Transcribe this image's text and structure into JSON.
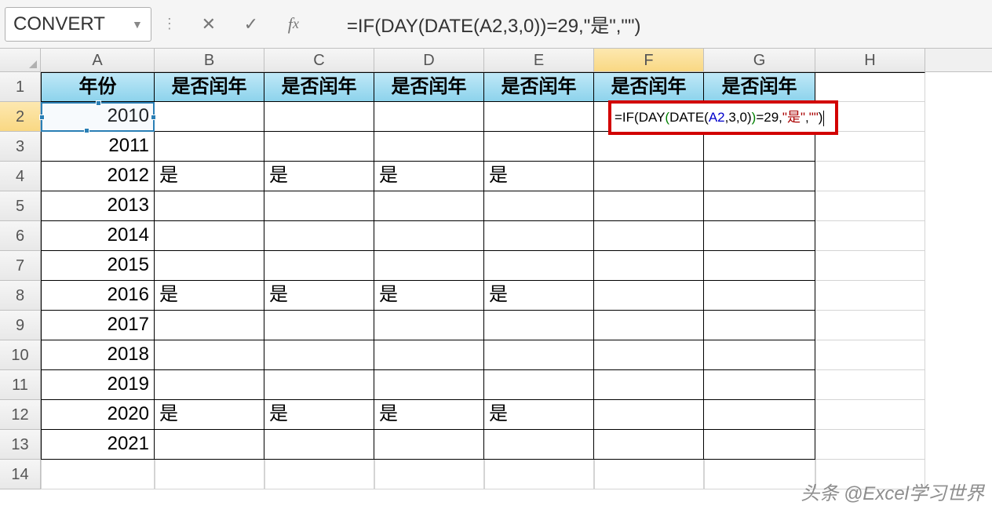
{
  "formula_bar": {
    "namebox": "CONVERT",
    "formula": "=IF(DAY(DATE(A2,3,0))=29,\"是\",\"\")"
  },
  "columns": [
    "A",
    "B",
    "C",
    "D",
    "E",
    "F",
    "G",
    "H"
  ],
  "header_row": {
    "A": "年份",
    "B": "是否闰年",
    "C": "是否闰年",
    "D": "是否闰年",
    "E": "是否闰年",
    "F": "是否闰年",
    "G": "是否闰年"
  },
  "rows": [
    {
      "n": 2,
      "A": "2010",
      "B": "",
      "C": "",
      "D": "",
      "E": "",
      "F": "",
      "G": "",
      "editingF": true
    },
    {
      "n": 3,
      "A": "2011",
      "B": "",
      "C": "",
      "D": "",
      "E": "",
      "F": "",
      "G": ""
    },
    {
      "n": 4,
      "A": "2012",
      "B": "是",
      "C": "是",
      "D": "是",
      "E": "是",
      "F": "",
      "G": ""
    },
    {
      "n": 5,
      "A": "2013",
      "B": "",
      "C": "",
      "D": "",
      "E": "",
      "F": "",
      "G": ""
    },
    {
      "n": 6,
      "A": "2014",
      "B": "",
      "C": "",
      "D": "",
      "E": "",
      "F": "",
      "G": ""
    },
    {
      "n": 7,
      "A": "2015",
      "B": "",
      "C": "",
      "D": "",
      "E": "",
      "F": "",
      "G": ""
    },
    {
      "n": 8,
      "A": "2016",
      "B": "是",
      "C": "是",
      "D": "是",
      "E": "是",
      "F": "",
      "G": ""
    },
    {
      "n": 9,
      "A": "2017",
      "B": "",
      "C": "",
      "D": "",
      "E": "",
      "F": "",
      "G": ""
    },
    {
      "n": 10,
      "A": "2018",
      "B": "",
      "C": "",
      "D": "",
      "E": "",
      "F": "",
      "G": ""
    },
    {
      "n": 11,
      "A": "2019",
      "B": "",
      "C": "",
      "D": "",
      "E": "",
      "F": "",
      "G": ""
    },
    {
      "n": 12,
      "A": "2020",
      "B": "是",
      "C": "是",
      "D": "是",
      "E": "是",
      "F": "",
      "G": ""
    },
    {
      "n": 13,
      "A": "2021",
      "B": "",
      "C": "",
      "D": "",
      "E": "",
      "F": "",
      "G": ""
    },
    {
      "n": 14,
      "A": "",
      "B": "",
      "C": "",
      "D": "",
      "E": "",
      "F": "",
      "G": "",
      "blank": true
    }
  ],
  "f2_edit_tokens": [
    {
      "t": "=IF",
      "c": "tok-black"
    },
    {
      "t": "(",
      "c": "tok-paren1"
    },
    {
      "t": "DAY",
      "c": "tok-black"
    },
    {
      "t": "(",
      "c": "tok-paren2"
    },
    {
      "t": "DATE",
      "c": "tok-black"
    },
    {
      "t": "(",
      "c": "tok-paren1"
    },
    {
      "t": "A2",
      "c": "tok-blue"
    },
    {
      "t": ",3,0",
      "c": "tok-black"
    },
    {
      "t": ")",
      "c": "tok-paren1"
    },
    {
      "t": ")",
      "c": "tok-paren2"
    },
    {
      "t": "=29,",
      "c": "tok-black"
    },
    {
      "t": "\"是\"",
      "c": "tok-str"
    },
    {
      "t": ",",
      "c": "tok-black"
    },
    {
      "t": "\"\"",
      "c": "tok-str"
    },
    {
      "t": ")",
      "c": "tok-paren1"
    }
  ],
  "watermark": "头条 @Excel学习世界",
  "selected_cell": "A2",
  "editing_cell": "F2"
}
